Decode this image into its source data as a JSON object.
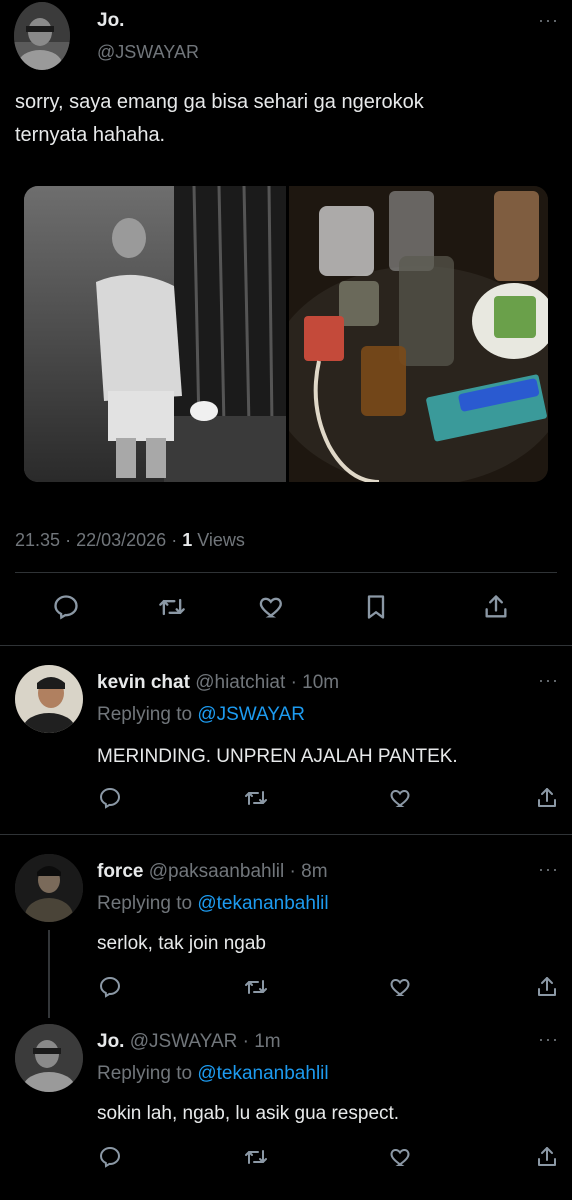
{
  "main_tweet": {
    "display_name": "Jo.",
    "handle": "@JSWAYAR",
    "text_line1": "sorry, saya emang ga bisa sehari ga ngerokok",
    "text_line2": "ternyata hahaha.",
    "time": "21.35",
    "dot": "·",
    "date": "22/03/2026",
    "views_count": "1",
    "views_label": "Views"
  },
  "replies": [
    {
      "display_name": "kevin chat",
      "handle": "@hiatchiat",
      "time": "· 10m",
      "replying_prefix": "Replying to",
      "replying_handle": "@JSWAYAR",
      "text": "MERINDING. UNPREN AJALAH PANTEK."
    },
    {
      "display_name": "force",
      "handle": "@paksaanbahlil",
      "time": "· 8m",
      "replying_prefix": "Replying to",
      "replying_handle": "@tekananbahlil",
      "text": "serlok, tak join ngab"
    },
    {
      "display_name": "Jo.",
      "handle": "@JSWAYAR",
      "time": "· 1m",
      "replying_prefix": "Replying to",
      "replying_handle": "@tekananbahlil",
      "text": "sokin lah, ngab, lu asik gua respect."
    }
  ],
  "more_glyph": "···",
  "icons": [
    "reply-icon",
    "retweet-icon",
    "like-icon",
    "bookmark-icon",
    "share-icon"
  ],
  "colors": {
    "background": "#000000",
    "text": "#e7e9ea",
    "muted": "#71767b",
    "link": "#1d9bf0",
    "divider": "#2f3336"
  }
}
